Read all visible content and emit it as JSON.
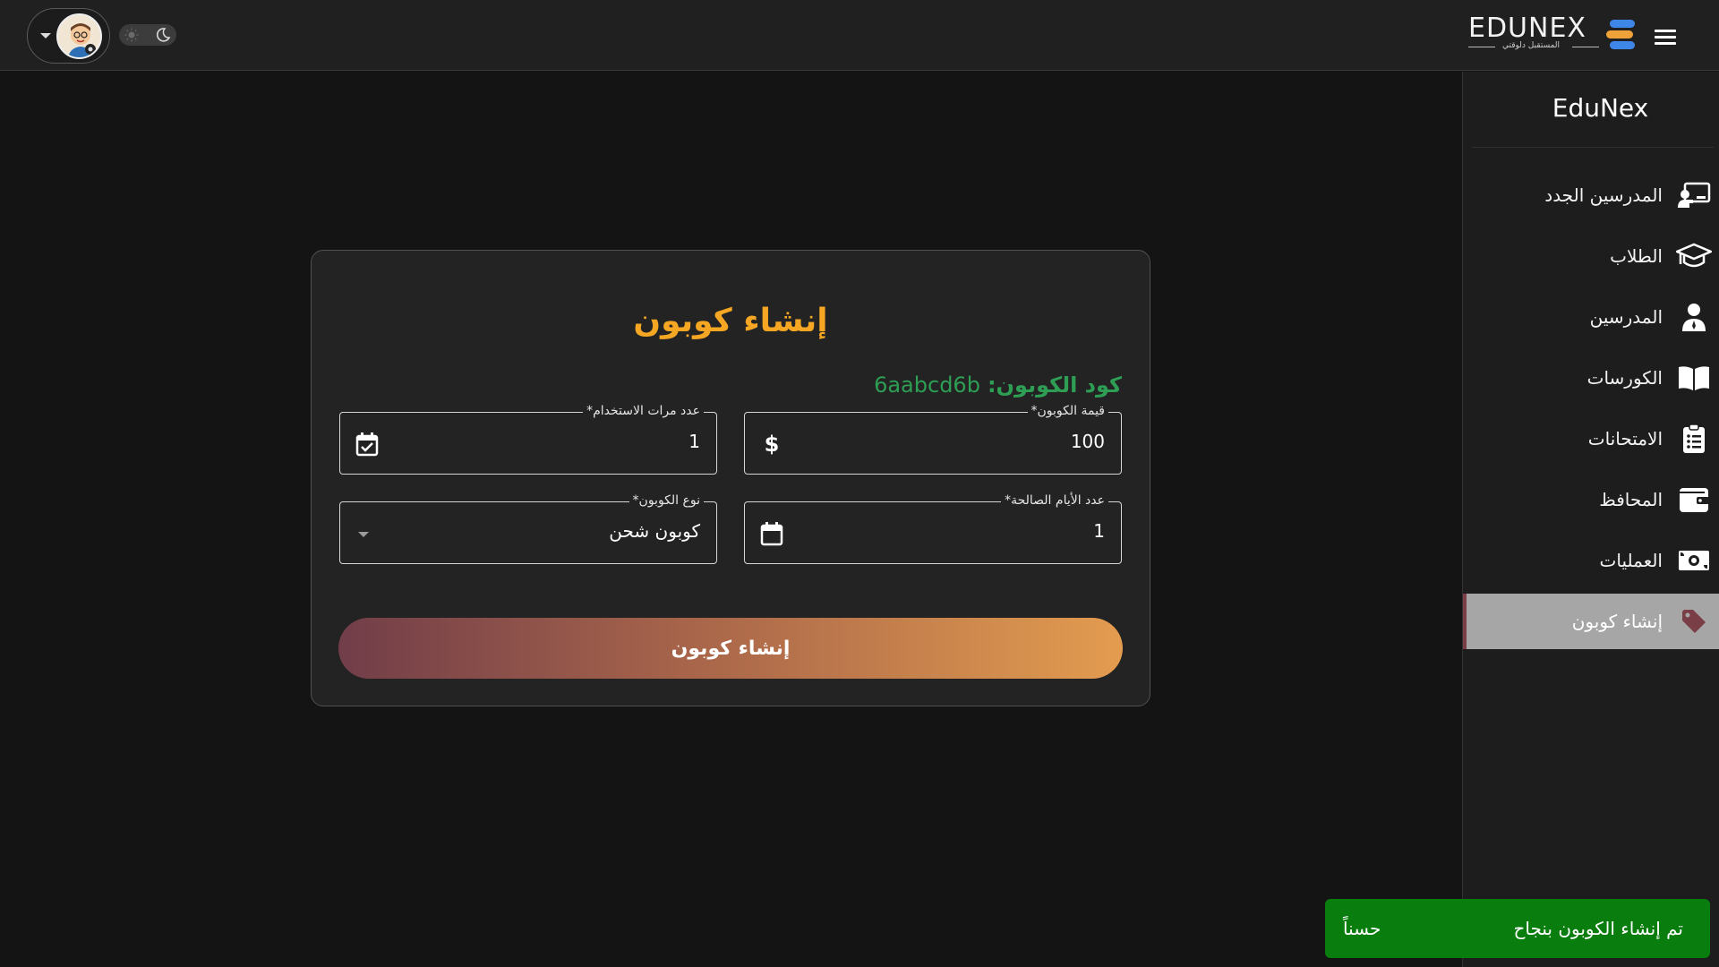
{
  "header": {
    "brand": "EDUNEX",
    "brand_tagline": "المستقبل دلوقتي"
  },
  "sidebar": {
    "title": "EduNex",
    "items": [
      {
        "label": "المدرسين الجدد",
        "icon": "teacher-board-icon"
      },
      {
        "label": "الطلاب",
        "icon": "graduation-cap-icon"
      },
      {
        "label": "المدرسين",
        "icon": "user-icon"
      },
      {
        "label": "الكورسات",
        "icon": "book-icon"
      },
      {
        "label": "الامتحانات",
        "icon": "clipboard-icon"
      },
      {
        "label": "المحافظ",
        "icon": "wallet-icon"
      },
      {
        "label": "العمليات",
        "icon": "money-icon"
      },
      {
        "label": "إنشاء كوبون",
        "icon": "tag-icon",
        "active": true
      }
    ]
  },
  "form": {
    "title": "إنشاء كوبون",
    "coupon_code_label": "كود الكوبون:",
    "coupon_code_value": "6aabcd6b",
    "fields": {
      "coupon_value": {
        "label": "قيمة الكوبون*",
        "value": "100"
      },
      "usage_count": {
        "label": "عدد مرات الاستخدام*",
        "value": "1"
      },
      "valid_days": {
        "label": "عدد الأيام الصالحة*",
        "value": "1"
      },
      "coupon_type": {
        "label": "نوع الكوبون*",
        "value": "كوبون شحن"
      }
    },
    "submit_label": "إنشاء كوبون"
  },
  "toast": {
    "message": "تم إنشاء الكوبون بنجاح",
    "action": "حسناً"
  },
  "colors": {
    "accent_orange": "#f5a623",
    "code_green": "#2e9e55",
    "toast_green": "#0a7d0f",
    "active_nav": "#a6a6a6"
  }
}
